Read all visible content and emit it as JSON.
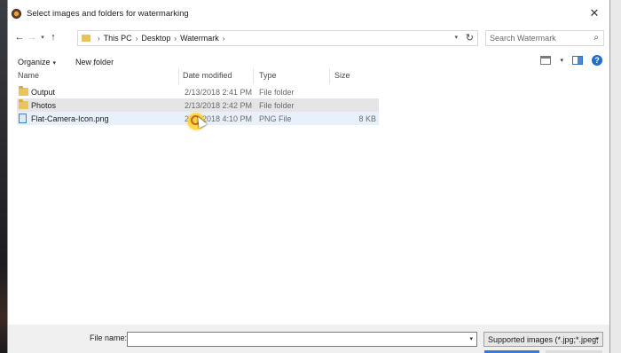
{
  "window": {
    "title": "Select images and folders for watermarking",
    "close_glyph": "✕"
  },
  "nav": {
    "back_glyph": "←",
    "forward_glyph": "→",
    "dropdown_glyph": "▾",
    "up_glyph": "↑",
    "breadcrumbs": [
      "This PC",
      "Desktop",
      "Watermark"
    ],
    "sep_glyph": "›",
    "refresh_glyph": "↻",
    "search_placeholder": "Search Watermark",
    "search_glyph": "⌕"
  },
  "toolbar": {
    "organize_label": "Organize",
    "new_folder_label": "New folder",
    "caret": "▾",
    "help_glyph": "?"
  },
  "columns": {
    "name": "Name",
    "date_modified": "Date modified",
    "type": "Type",
    "size": "Size"
  },
  "files": [
    {
      "name": "Output",
      "date": "2/13/2018 2:41 PM",
      "type": "File folder",
      "size": "",
      "icon": "folder-icon"
    },
    {
      "name": "Photos",
      "date": "2/13/2018 2:42 PM",
      "type": "File folder",
      "size": "",
      "icon": "folder-icon"
    },
    {
      "name": "Flat-Camera-Icon.png",
      "date": "2/13/2018 4:10 PM",
      "type": "PNG File",
      "size": "8 KB",
      "icon": "image-file-icon"
    }
  ],
  "footer": {
    "file_name_label": "File name:",
    "file_name_value": "",
    "filter_value": "Supported images (*.jpg;*.jpeg;",
    "caret": "▾"
  },
  "colors": {
    "selected_row": "#e5e5e5",
    "hover_row": "#e8f1fb",
    "folder": "#e9c45c",
    "accent": "#1f6fd1"
  }
}
